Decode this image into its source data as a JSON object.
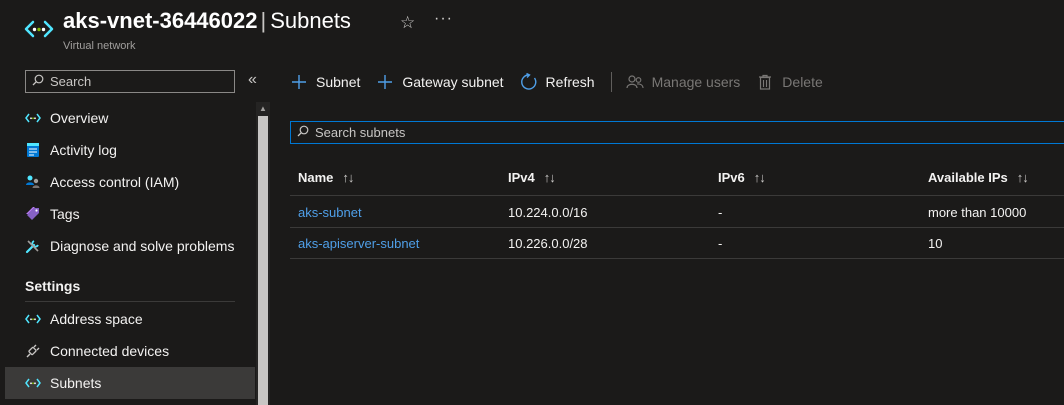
{
  "header": {
    "resource_name": "aks-vnet-36446022",
    "separator": "|",
    "page_title": "Subnets",
    "subtitle": "Virtual network",
    "star_icon": "★-outline",
    "more_label": "···"
  },
  "sidebar": {
    "search_placeholder": "Search",
    "collapse_label": "«",
    "items": [
      {
        "label": "Overview",
        "icon": "vnet-icon"
      },
      {
        "label": "Activity log",
        "icon": "activity-log-icon"
      },
      {
        "label": "Access control (IAM)",
        "icon": "iam-icon"
      },
      {
        "label": "Tags",
        "icon": "tag-icon"
      },
      {
        "label": "Diagnose and solve problems",
        "icon": "wrench-icon"
      }
    ],
    "section_title": "Settings",
    "settings_items": [
      {
        "label": "Address space",
        "icon": "vnet-icon"
      },
      {
        "label": "Connected devices",
        "icon": "plug-icon"
      },
      {
        "label": "Subnets",
        "icon": "vnet-icon",
        "selected": true
      }
    ]
  },
  "toolbar": {
    "subnet_label": "Subnet",
    "gateway_label": "Gateway subnet",
    "refresh_label": "Refresh",
    "manage_users_label": "Manage users",
    "delete_label": "Delete"
  },
  "search": {
    "placeholder": "Search subnets"
  },
  "table": {
    "columns": [
      "Name",
      "IPv4",
      "IPv6",
      "Available IPs"
    ],
    "sort_glyph": "↑↓",
    "rows": [
      {
        "name": "aks-subnet",
        "ipv4": "10.224.0.0/16",
        "ipv6": "-",
        "available": "more than 10000"
      },
      {
        "name": "aks-apiserver-subnet",
        "ipv4": "10.226.0.0/28",
        "ipv6": "-",
        "available": "10"
      }
    ]
  },
  "colors": {
    "background": "#1b1a19",
    "accent": "#0078d4",
    "link": "#4f9fe8",
    "vnet_icon": "#50e6ff"
  }
}
